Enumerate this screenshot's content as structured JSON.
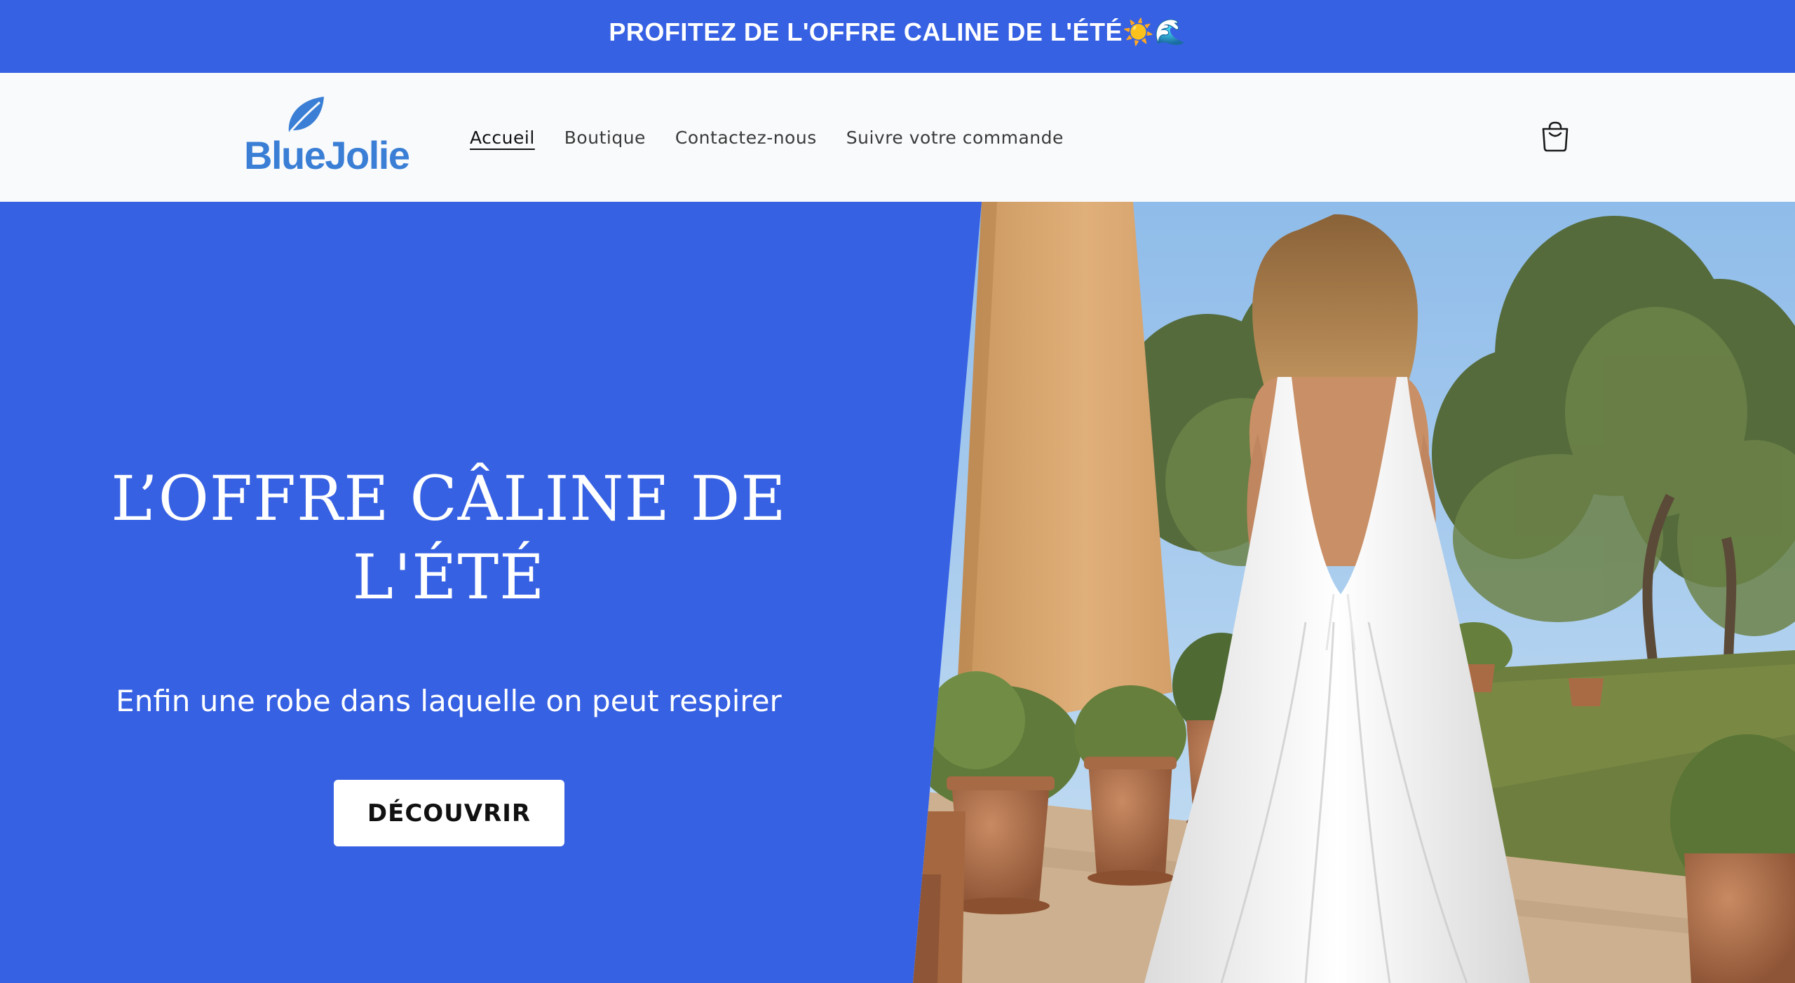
{
  "announcement": {
    "text": "PROFITEZ DE L'OFFRE CALINE DE L'ÉTÉ☀️🌊"
  },
  "header": {
    "logo_text": "BlueJolie",
    "nav": [
      {
        "label": "Accueil",
        "active": true
      },
      {
        "label": "Boutique",
        "active": false
      },
      {
        "label": "Contactez-nous",
        "active": false
      },
      {
        "label": "Suivre votre commande",
        "active": false
      }
    ],
    "cart_icon": "shopping-bag-icon"
  },
  "hero": {
    "title": "L’OFFRE CÂLINE DE L'ÉTÉ",
    "subtitle": "Enfin une robe dans laquelle on peut respirer",
    "button_label": "DÉCOUVRIR",
    "image_alt": "woman in white backless maxi dress among olive trees and terracotta pots"
  },
  "colors": {
    "brand_blue": "#3761e3",
    "logo_blue": "#3a7fd5",
    "header_bg": "#f9fafc",
    "text_dark": "#111111"
  }
}
